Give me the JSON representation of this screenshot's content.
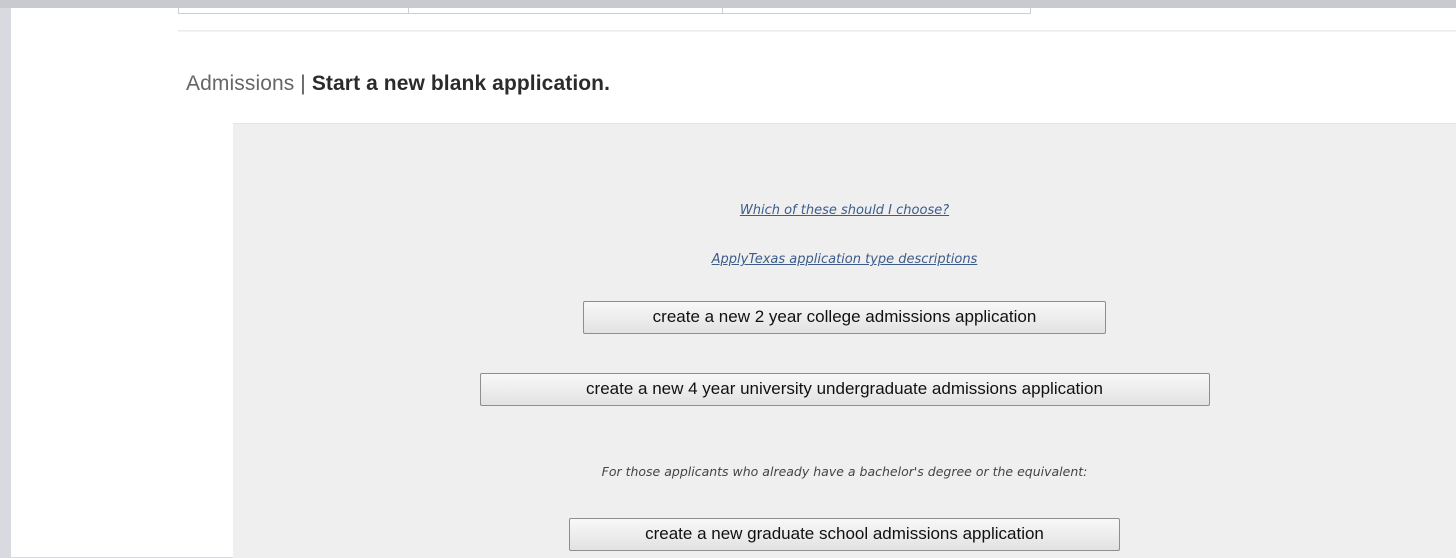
{
  "header": {
    "section": "Admissions",
    "separator": " | ",
    "subtitle": "Start a new blank application."
  },
  "links": {
    "which_to_choose": "Which of these should I choose?",
    "type_descriptions": "ApplyTexas application type descriptions"
  },
  "buttons": {
    "two_year": "create a new 2 year college admissions application",
    "four_year": "create a new 4 year university undergraduate admissions application",
    "graduate": "create a new graduate school admissions application"
  },
  "note": "For those applicants who already have a bachelor's degree or the equivalent:",
  "colors": {
    "background": "#d9dadf",
    "panel": "#efefef",
    "link": "#3d5c8a"
  }
}
